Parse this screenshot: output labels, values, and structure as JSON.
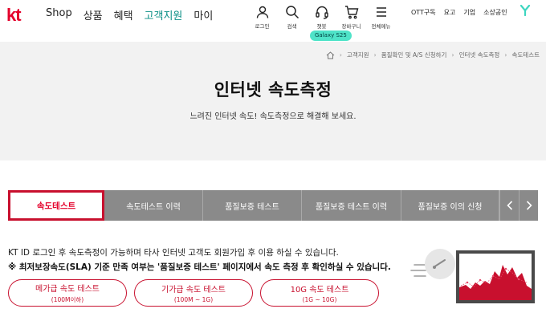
{
  "header": {
    "logo": "kt",
    "nav": [
      {
        "label": "Shop"
      },
      {
        "label": "상품"
      },
      {
        "label": "혜택"
      },
      {
        "label": "고객지원",
        "active": true
      },
      {
        "label": "마이"
      }
    ],
    "utility": [
      {
        "label": "로그인",
        "icon": "person-icon"
      },
      {
        "label": "검색",
        "icon": "search-icon"
      },
      {
        "label": "챗봇",
        "icon": "headset-icon"
      },
      {
        "label": "장바구니",
        "icon": "cart-icon"
      },
      {
        "label": "전체메뉴",
        "icon": "menu-icon"
      }
    ],
    "promo_badge": "Galaxy S25",
    "side_links": [
      "OTT구독",
      "요고",
      "기업",
      "소상공인"
    ],
    "brand_color": "#e4002b",
    "active_nav_color": "#0b8f86"
  },
  "breadcrumb": [
    "고객지원",
    "품질확인 및 A/S 신청하기",
    "인터넷 속도측정",
    "속도테스트"
  ],
  "hero": {
    "title": "인터넷 속도측정",
    "subtitle": "느려진 인터넷 속도! 속도측정으로 해결해 보세요."
  },
  "tabs": [
    {
      "label": "속도테스트",
      "active": true
    },
    {
      "label": "속도테스트 이력"
    },
    {
      "label": "품질보증 테스트"
    },
    {
      "label": "품질보증 테스트 이력"
    },
    {
      "label": "품질보증 이의 신청"
    }
  ],
  "notice": {
    "line1": "KT ID 로그인 후 속도측정이 가능하며 타사 인터넷 고객도 회원가입 후 이용 하실 수 있습니다.",
    "line2": "※ 최저보장속도(SLA) 기준 만족 여부는 '품질보증 테스트' 페이지에서 속도 측정 후 확인하실 수 있습니다."
  },
  "speed_tests": [
    {
      "label": "메가급 속도 테스트",
      "range": "(100M이하)"
    },
    {
      "label": "기가급 속도 테스트",
      "range": "(100M ~ 1G)"
    },
    {
      "label": "10G 속도 테스트",
      "range": "(1G ~ 10G)"
    }
  ]
}
